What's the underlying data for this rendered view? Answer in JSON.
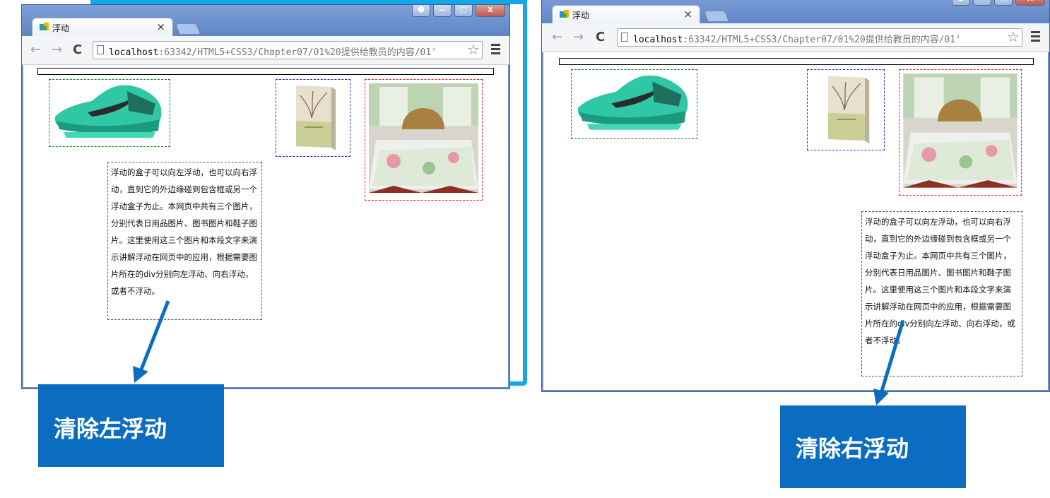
{
  "windows": [
    {
      "tab_title": "浮动",
      "tab_close": "×",
      "url_host": "localhost",
      "url_rest": ":63342/HTML5+CSS3/Chapter07/01%20提供给教员的内容/01'",
      "paragraph": "浮动的盒子可以向左浮动，也可以向右浮动，直到它的外边缘碰到包含框或另一个浮动盒子为止。本网页中共有三个图片，分别代表日用品图片、图书图片和鞋子图片。这里使用这三个图片和本段文字来演示讲解浮动在网页中的应用，根据需要图片所在的div分别向左浮动、向右浮动，或者不浮动。",
      "caption": "清除左浮动"
    },
    {
      "tab_title": "浮动",
      "tab_close": "×",
      "url_host": "localhost",
      "url_rest": ":63342/HTML5+CSS3/Chapter07/01%20提供给教员的内容/01'",
      "paragraph": "浮动的盒子可以向左浮动，也可以向右浮动，直到它的外边缘碰到包含框或另一个浮动盒子为止。本网页中共有三个图片，分别代表日用品图片、图书图片和鞋子图片。这里使用这三个图片和本段文字来演示讲解浮动在网页中的应用，根据需要图片所在的div分别向左浮动、向右浮动，或者不浮动。",
      "caption": "清除右浮动"
    }
  ],
  "icons": {
    "back": "←",
    "forward": "→",
    "reload": "C",
    "star": "☆",
    "win_user": "user-icon",
    "win_min": "minimize-icon",
    "win_max": "maximize-icon",
    "win_close": "X"
  },
  "colors": {
    "accent": "#0b6dc1",
    "frame": "#14a6e6",
    "shoe_box": "#1c7a1c",
    "book_box": "#2323d6",
    "bed_box": "#e02323"
  }
}
